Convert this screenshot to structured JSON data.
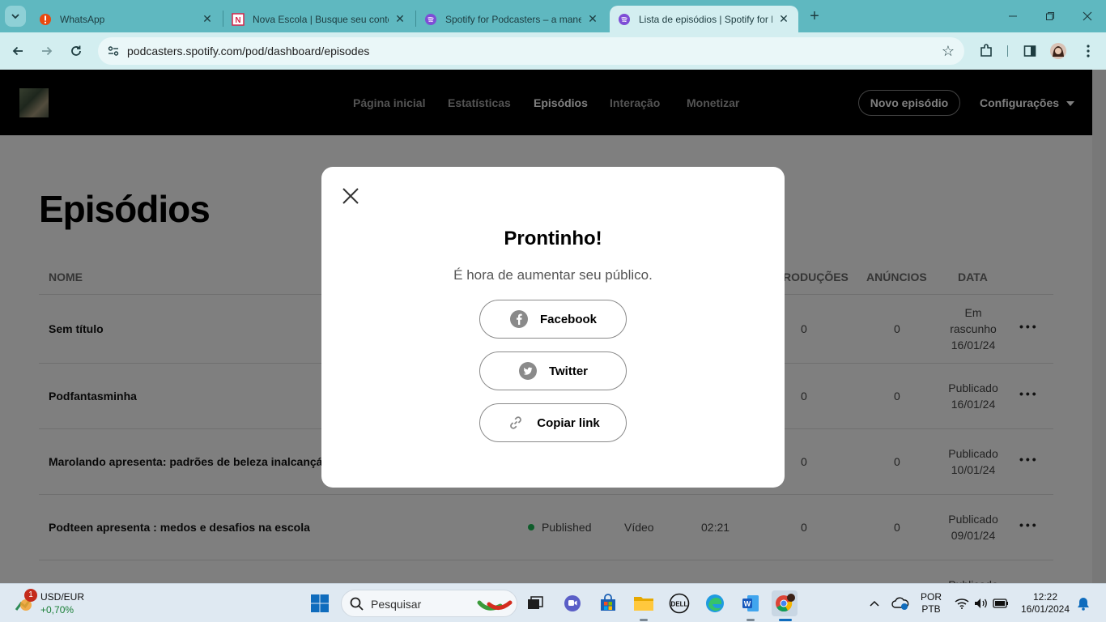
{
  "browser": {
    "tabs": [
      {
        "title": "WhatsApp",
        "icon": "whatsapp-alert-icon"
      },
      {
        "title": "Nova Escola | Busque seu conte",
        "icon": "nova-escola-icon"
      },
      {
        "title": "Spotify for Podcasters – a mane",
        "icon": "spotify-podcasters-icon"
      },
      {
        "title": "Lista de episódios | Spotify for P",
        "icon": "spotify-podcasters-icon",
        "active": true
      }
    ],
    "url": "podcasters.spotify.com/pod/dashboard/episodes"
  },
  "topnav": {
    "links": [
      "Página inicial",
      "Estatísticas",
      "Episódios",
      "Interação",
      "Monetizar"
    ],
    "active": "Episódios",
    "new_episode": "Novo episódio",
    "settings": "Configurações"
  },
  "page": {
    "title": "Episódios",
    "columns": {
      "name": "NOME",
      "plays": "RODUÇÕES",
      "ads": "ANÚNCIOS",
      "date": "DATA"
    },
    "rows": [
      {
        "name": "Sem título",
        "status": "",
        "type": "",
        "duration": "",
        "plays": "0",
        "ads": "0",
        "date_line1": "Em",
        "date_line2": "rascunho",
        "date_line3": "16/01/24"
      },
      {
        "name": "Podfantasminha",
        "status": "",
        "type": "",
        "duration": "",
        "plays": "0",
        "ads": "0",
        "date_line1": "Publicado",
        "date_line2": "16/01/24",
        "date_line3": ""
      },
      {
        "name": "Marolando apresenta: padrões de beleza inalcançáv",
        "status": "",
        "type": "",
        "duration": "",
        "plays": "0",
        "ads": "0",
        "date_line1": "Publicado",
        "date_line2": "10/01/24",
        "date_line3": ""
      },
      {
        "name": "Podteen apresenta : medos e desafios na escola",
        "status": "Published",
        "type": "Vídeo",
        "duration": "02:21",
        "plays": "0",
        "ads": "0",
        "date_line1": "Publicado",
        "date_line2": "09/01/24",
        "date_line3": ""
      }
    ],
    "partial_row_date": "Publicado",
    "more_label": "•••"
  },
  "modal": {
    "title": "Prontinho!",
    "subtitle": "É hora de aumentar seu público.",
    "buttons": {
      "facebook": "Facebook",
      "twitter": "Twitter",
      "copy": "Copiar link"
    }
  },
  "taskbar": {
    "widget_title": "USD/EUR",
    "widget_value": "+0,70%",
    "widget_badge": "1",
    "search_placeholder": "Pesquisar",
    "lang_line1": "POR",
    "lang_line2": "PTB",
    "time": "12:22",
    "date": "16/01/2024"
  },
  "colors": {
    "accent": "#1db954",
    "tabstrip": "#5fb8c0",
    "toolbar": "#d3eef0"
  }
}
